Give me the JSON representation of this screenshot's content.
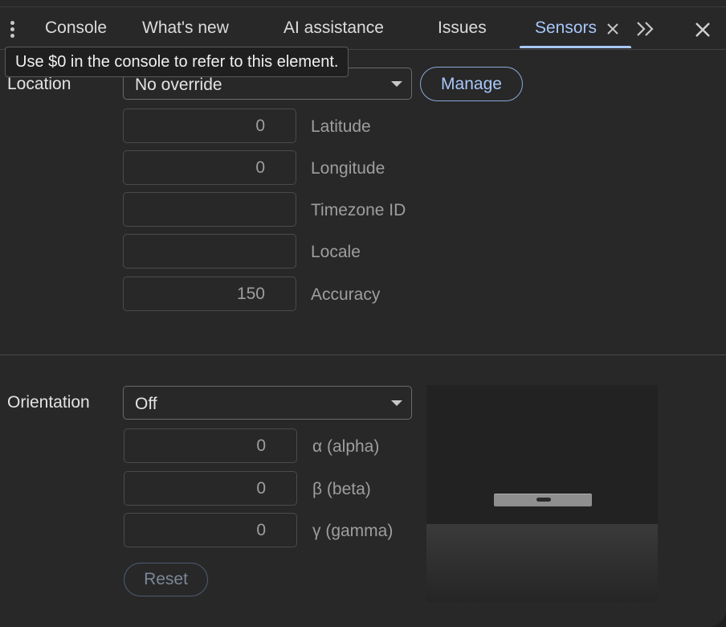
{
  "tabs": [
    {
      "label": "Console"
    },
    {
      "label": "What's new"
    },
    {
      "label": "AI assistance"
    },
    {
      "label": "Issues"
    },
    {
      "label": "Sensors",
      "active": true
    }
  ],
  "tooltip": "Use $0 in the console to refer to this element.",
  "location": {
    "label": "Location",
    "select_value": "No override",
    "manage_label": "Manage",
    "fields": [
      {
        "label": "Latitude",
        "value": "0"
      },
      {
        "label": "Longitude",
        "value": "0"
      },
      {
        "label": "Timezone ID",
        "value": ""
      },
      {
        "label": "Locale",
        "value": ""
      },
      {
        "label": "Accuracy",
        "value": "150"
      }
    ]
  },
  "orientation": {
    "label": "Orientation",
    "select_value": "Off",
    "fields": [
      {
        "label": "α (alpha)",
        "value": "0"
      },
      {
        "label": "β (beta)",
        "value": "0"
      },
      {
        "label": "γ (gamma)",
        "value": "0"
      }
    ],
    "reset_label": "Reset"
  },
  "icons": {
    "menu": "kebab-menu-icon",
    "tab_close": "close-icon",
    "more_tabs": "chevron-double-right-icon",
    "panel_close": "close-icon"
  },
  "colors": {
    "accent": "#a8c7fa",
    "background": "#282828",
    "text": "#e3e3e3",
    "muted_text": "#9e9e9e"
  }
}
